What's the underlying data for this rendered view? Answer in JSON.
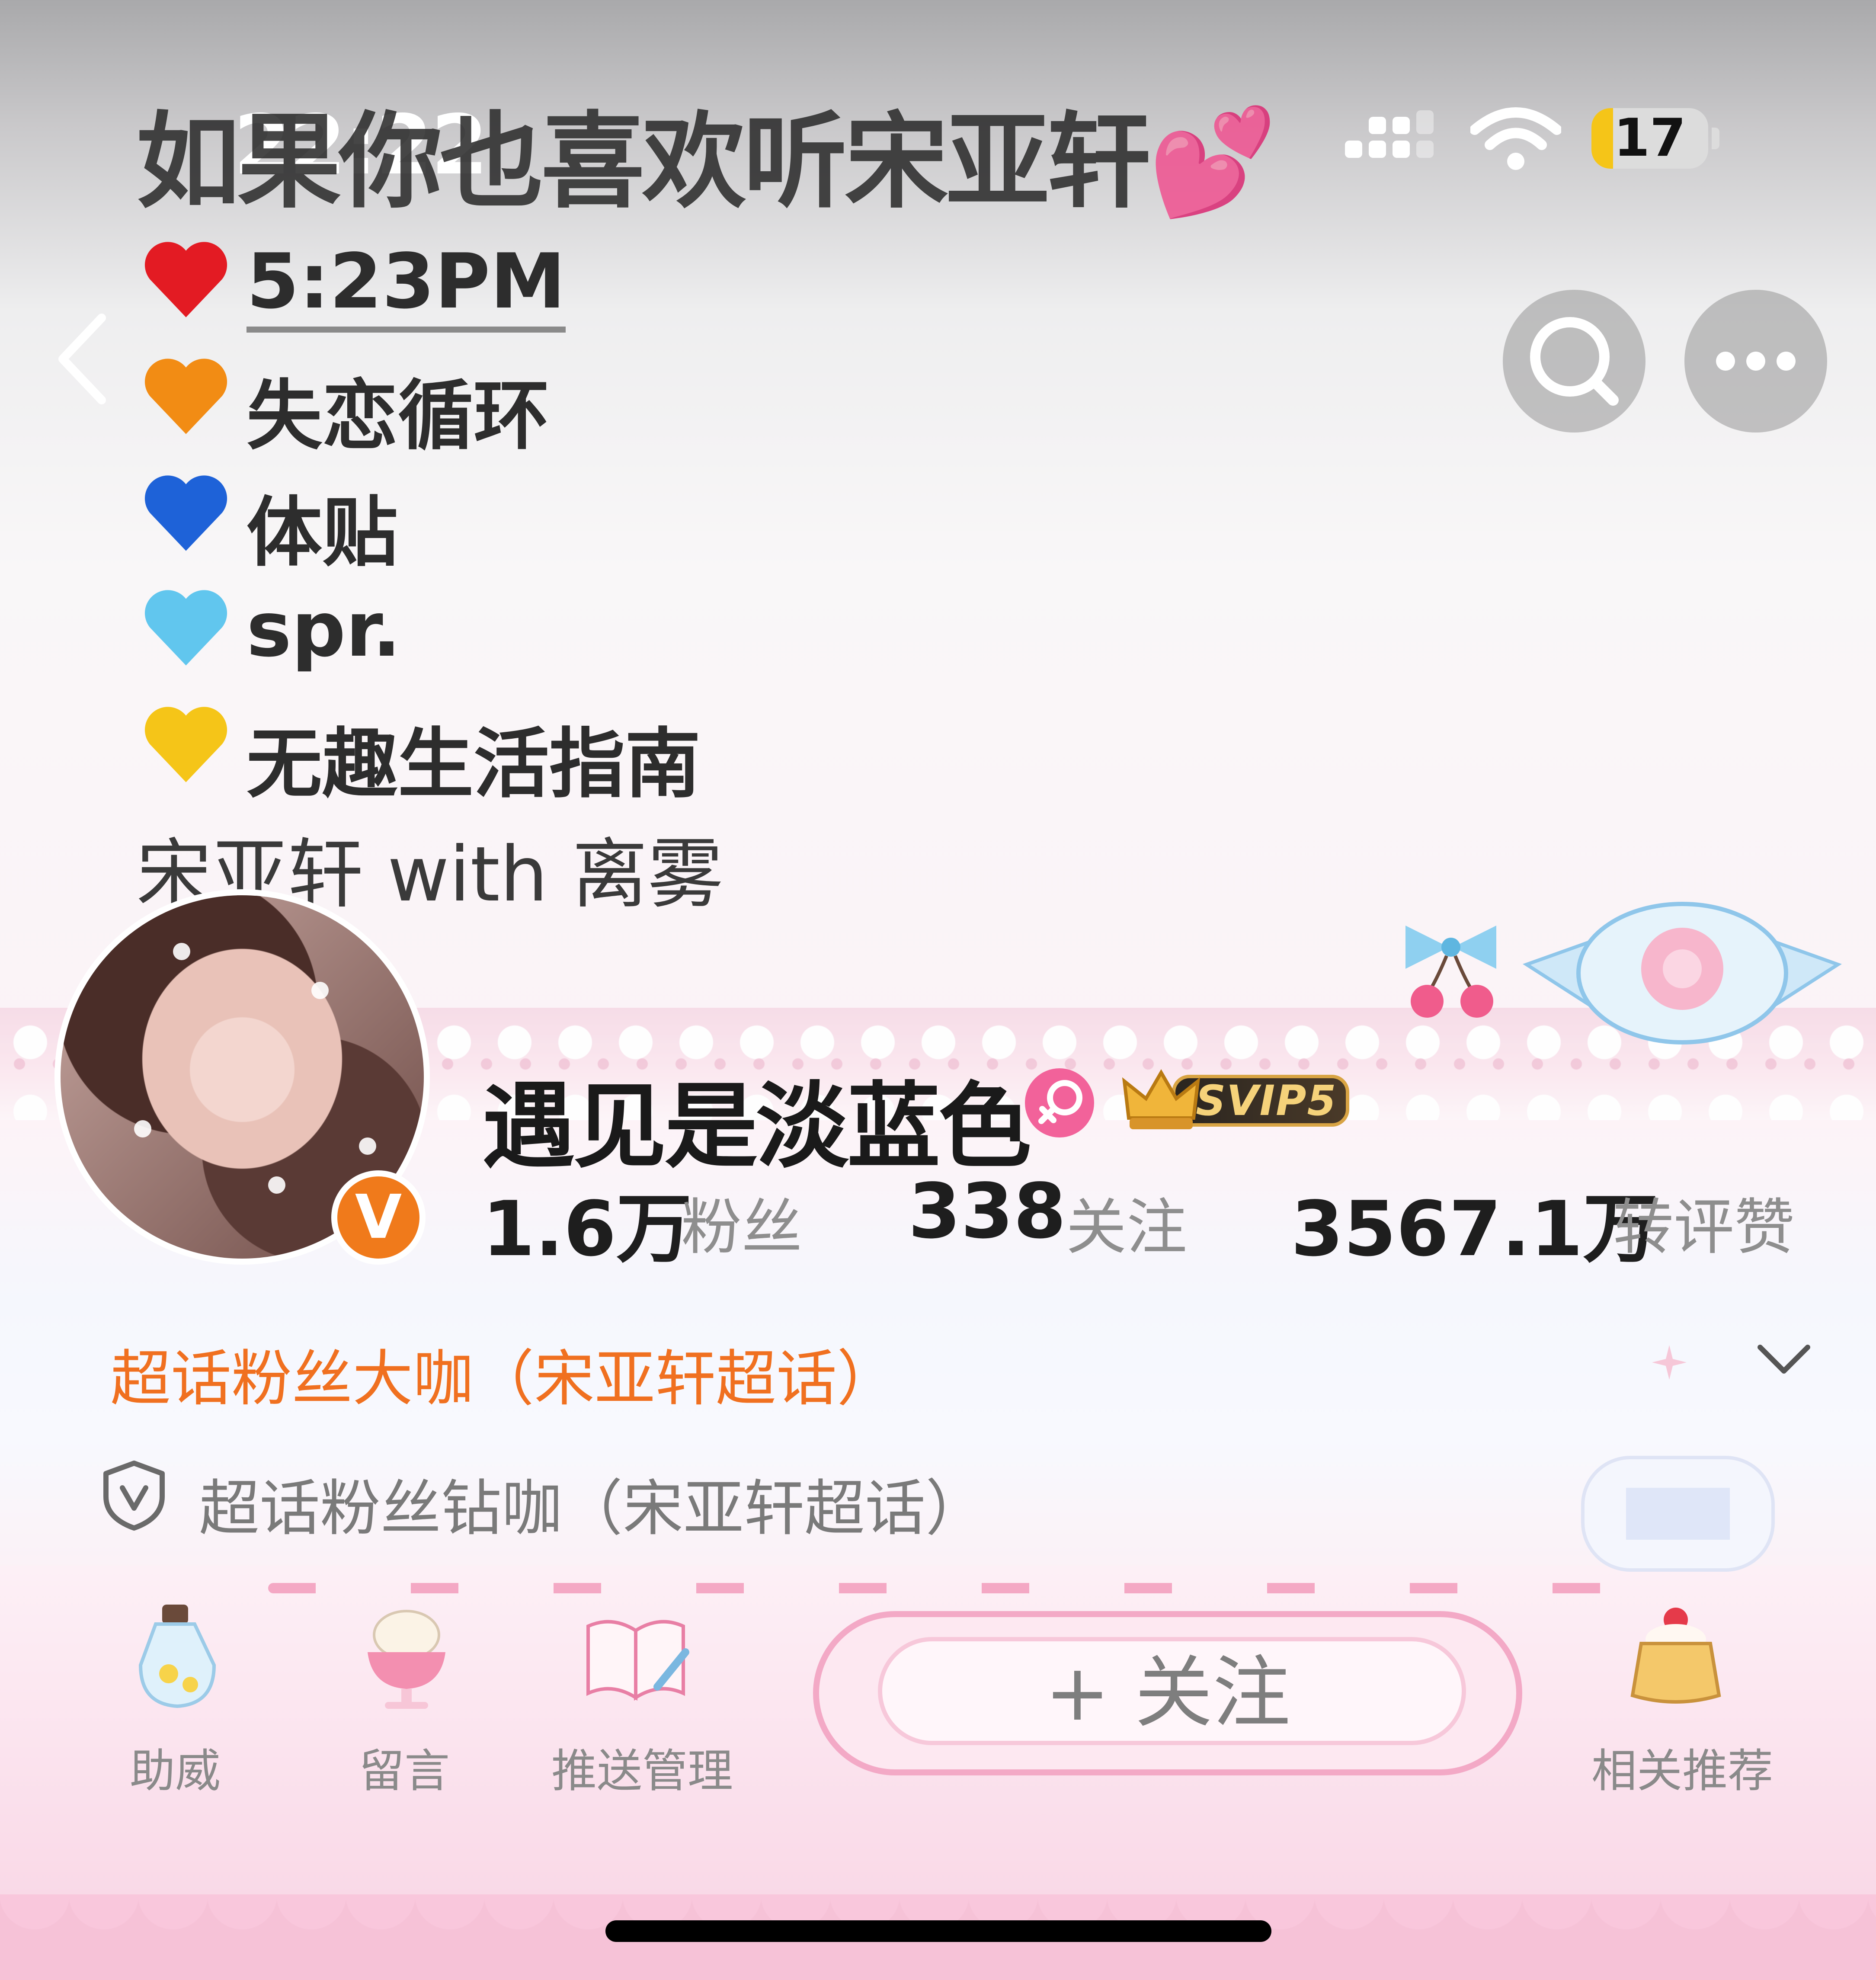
{
  "status_bar": {
    "time": "22:22",
    "battery": "17"
  },
  "cover": {
    "title": "如果你也喜欢听宋亚轩💕",
    "songs": [
      {
        "heart": "red-heart-icon",
        "color": "#e31b23",
        "title": "5:23PM"
      },
      {
        "heart": "orange-heart-icon",
        "color": "#f28c14",
        "title": "失恋循环"
      },
      {
        "heart": "blue-heart-icon",
        "color": "#1e62d8",
        "title": "体贴"
      },
      {
        "heart": "light-blue-heart-icon",
        "color": "#61c6ee",
        "title": "spr."
      },
      {
        "heart": "yellow-heart-icon",
        "color": "#f5c518",
        "title": "无趣生活指南"
      }
    ],
    "credit": "宋亚轩 with 离雾"
  },
  "profile": {
    "username": "遇见是淡蓝色",
    "vip_badge": "SVIP5",
    "stats": [
      {
        "value": "1.6万",
        "label": "粉丝"
      },
      {
        "value": "338",
        "label": "关注"
      },
      {
        "value": "3567.1万",
        "label": "转评赞"
      }
    ],
    "fan_title": "超话粉丝大咖（宋亚轩超话）",
    "fan_line": "超话粉丝钻咖（宋亚轩超话）"
  },
  "actions": {
    "support": "助威",
    "message": "留言",
    "push": "推送管理",
    "follow": "+ 关注",
    "related": "相关推荐"
  },
  "colors": {
    "accent_orange": "#f07020",
    "verified_orange": "#f07a1b",
    "gender_pink": "#f2629a",
    "bottom_pink": "#f6c2d7"
  }
}
